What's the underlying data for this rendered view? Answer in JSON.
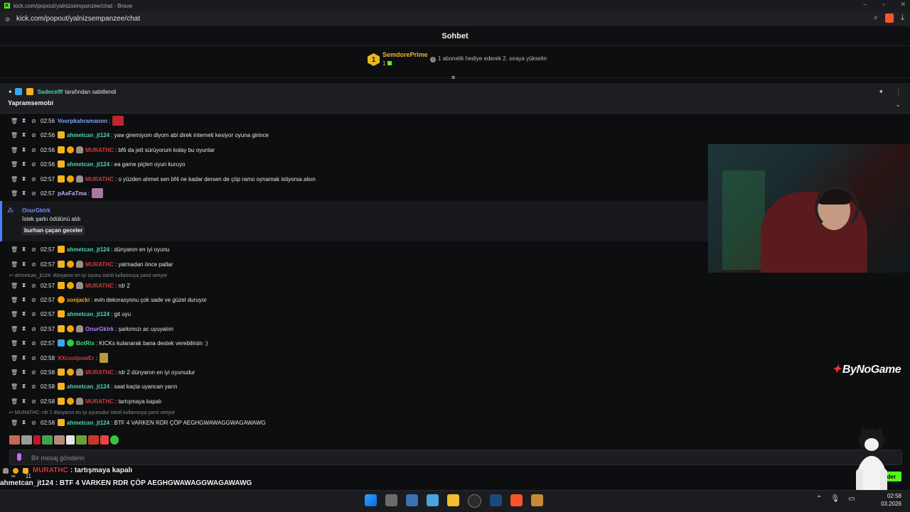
{
  "browser": {
    "title": "kick.com/popout/yalnizsempanzee/chat - Brave",
    "url": "kick.com/popout/yalnizsempanzee/chat"
  },
  "chat": {
    "title": "Sohbet",
    "leaderboard": {
      "rank": "1",
      "name": "SemdorePrime",
      "count": "1",
      "info": "1 abonelik hediye ederek 2. sıraya yükselin"
    },
    "pinned": {
      "pinned_by_user": "Sadecelff",
      "pinned_by_text": "tarafından sabitlendi",
      "message": "Yapramsemobi"
    },
    "messages_top": [
      {
        "time": "02:56",
        "user": "Voorpkahramannn",
        "text": ""
      },
      {
        "time": "02:56",
        "user": "ahmetcan_jt124",
        "text": "yaw giremiyom diyom abi direk interneti kesiyor oyuna girince"
      },
      {
        "time": "02:56",
        "user": "MURATHC",
        "text": "bf6 da jett sürüyorum kolay bu oyunlar"
      },
      {
        "time": "02:56",
        "user": "ahmetcan_jt124",
        "text": "ea game piçleri oyun kuruyo"
      },
      {
        "time": "02:57",
        "user": "MURATHC",
        "text": "o yüzden ahmet sen bf4 ne kadar dersen de çöp ramo oynamak istiyorsa alsın"
      },
      {
        "time": "02:57",
        "user": "pAxFaTma",
        "text": ""
      }
    ],
    "reward": {
      "user": "OnurGktrk",
      "description": "İstek şarkı ödülünü aldı",
      "song": "burhan çaçan geceler"
    },
    "messages_bottom": [
      {
        "time": "02:57",
        "user": "ahmetcan_jt124",
        "text": "dünyanın en iyi oyunu"
      },
      {
        "time": "02:57",
        "user": "MURATHC",
        "text": "yatmadan önce patlar"
      },
      {
        "time": "02:57",
        "user": "MURATHC",
        "text": "rdr 2"
      },
      {
        "time": "02:57",
        "user": "sonjacki",
        "text": "evin dekorasyonu çok sade ve güzel duruyor"
      },
      {
        "time": "02:57",
        "user": "ahmetcan_jt124",
        "text": "git uyu"
      },
      {
        "time": "02:57",
        "user": "OnurGktrk",
        "text": "şarkımızı ac uyuyalım"
      },
      {
        "time": "02:57",
        "user": "BotRix",
        "text": "KICKs kulanarak bana destek verebilirsin :)"
      },
      {
        "time": "02:58",
        "user": "XXcoolpowEr",
        "text": ""
      },
      {
        "time": "02:58",
        "user": "MURATHC",
        "text": "rdr 2 dünyanın en iyi oyunudur"
      },
      {
        "time": "02:58",
        "user": "ahmetcan_jt124",
        "text": "saat kaçta uyancan yarın"
      },
      {
        "time": "02:58",
        "user": "MURATHC",
        "text": "tartışmaya kapalı"
      },
      {
        "time": "02:58",
        "user": "ahmetcan_jt124",
        "text": "BTF 4 VARKEN RDR ÇÖP AEGHGWAWAGGWAGAWAWG"
      }
    ],
    "replies": [
      "ahmetcan_jt124: dünyanın en iyi oyunu isimli kullanıcıya yanıt veriyor",
      "MURATHC: rdr 2 dünyanın en iyi oyunudur isimli kullanıcıya yanıt veriyor"
    ],
    "input_placeholder": "Bir mesaj gönderin",
    "send_label": "der"
  },
  "overlay": {
    "line1_user": "MURATHC",
    "line1_text": ": tartışmaya kapalı",
    "line2": "ahmetcan_jt124 : BTF 4 VARKEN RDR ÇÖP AEGHGWAWAGGWAGAWAWG",
    "stat_a": "∞",
    "stat_b": "11",
    "watermark": "ByNoGame"
  },
  "taskbar": {
    "time": "02:58",
    "date": "03.2026"
  },
  "colors": {
    "kick_green": "#53fc18",
    "crown": "#f6b321",
    "blue_user": "#7aa6ff",
    "teal_user": "#4bd6b4",
    "red_user": "#d23a3a"
  }
}
